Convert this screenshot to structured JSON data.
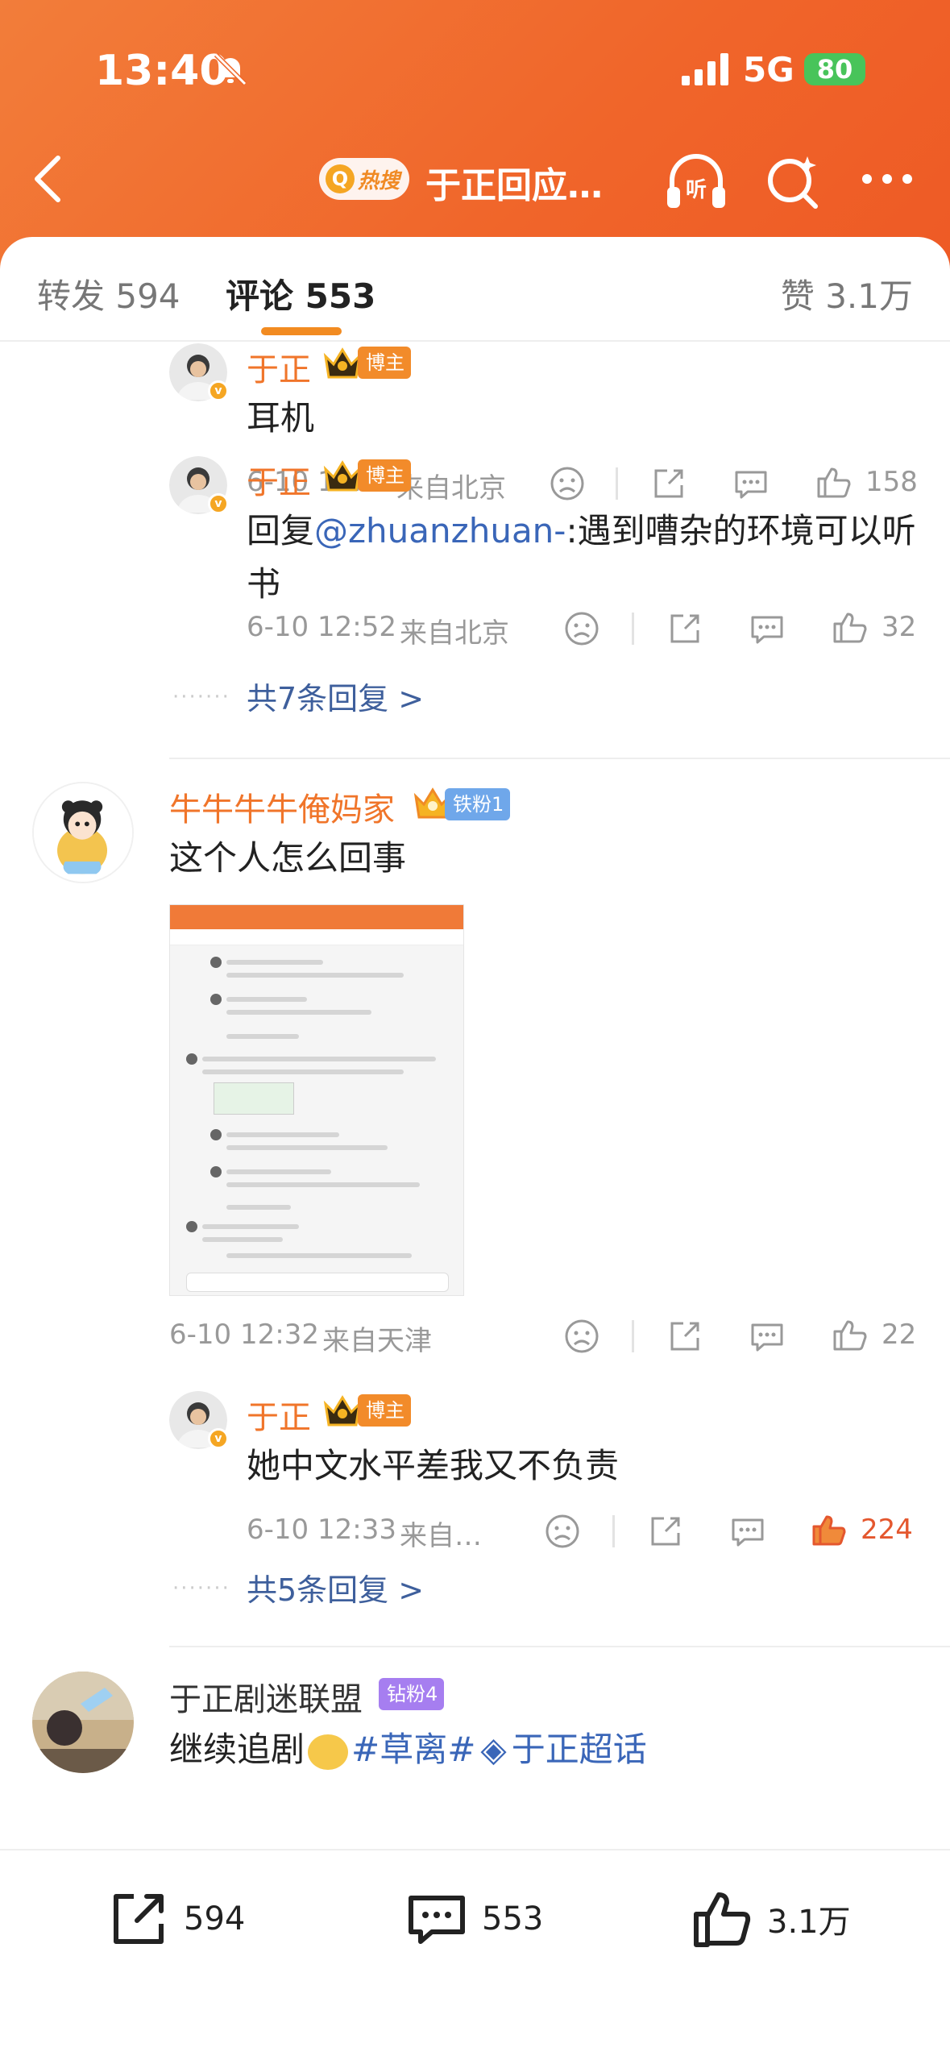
{
  "status_bar": {
    "time": "13:40",
    "network": "5G",
    "battery": "80"
  },
  "header": {
    "hot_label": "热搜",
    "title": "于正回应…"
  },
  "tabs": {
    "repost": "转发 594",
    "comment": "评论 553",
    "likes": "赞 3.1万"
  },
  "comments": [
    {
      "user": "于正",
      "tag": "博主",
      "text": "耳机",
      "time": "6-10 11:56",
      "source": "来自北京",
      "likes": "158"
    },
    {
      "user": "于正",
      "tag": "博主",
      "reply_prefix": "回复",
      "mention": "@zhuanzhuan-",
      "text": ":遇到嘈杂的环境可以听书",
      "time": "6-10 12:52",
      "source": "来自北京",
      "likes": "32"
    },
    {
      "more_replies": "共7条回复 >"
    },
    {
      "user": "牛牛牛牛俺妈家",
      "tag": "铁粉1",
      "text": "这个人怎么回事",
      "time": "6-10 12:32",
      "source": "来自天津",
      "likes": "22"
    },
    {
      "user": "于正",
      "tag": "博主",
      "text": "她中文水平差我又不负责",
      "time": "6-10 12:33",
      "source": "来自…",
      "likes": "224"
    },
    {
      "more_replies": "共5条回复 >"
    },
    {
      "user": "于正剧迷联盟",
      "tag": "钻粉4",
      "text_start": "继续追剧",
      "topic": "#草离#",
      "super_topic": "于正超话"
    }
  ],
  "bottom_bar": {
    "repost": "594",
    "comment": "553",
    "like": "3.1万"
  },
  "colors": {
    "accent": "#f0752a",
    "link": "#3e5f9c",
    "like_active": "#e4572e"
  }
}
